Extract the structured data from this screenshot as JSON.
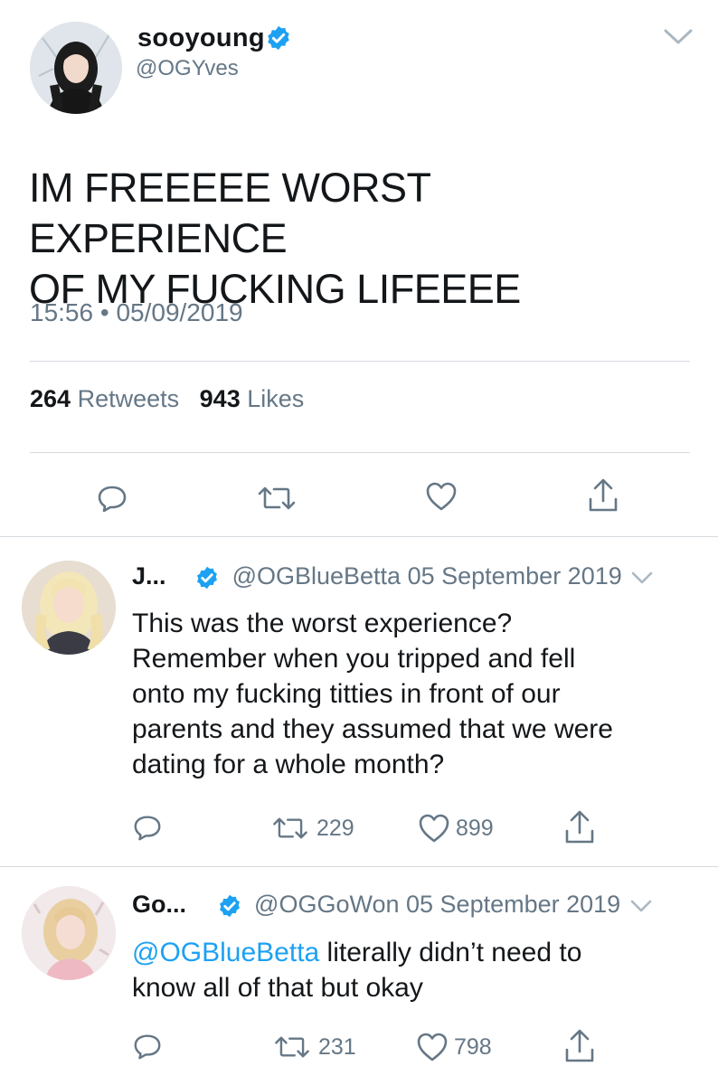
{
  "tweet": {
    "name": "sooyoung",
    "handle": "@OGYves",
    "text_line1": "IM FREEEEE WORST EXPERIENCE",
    "text_line2": "OF MY FUCKING LIFEEEE",
    "time": "15:56",
    "date": "05/09/2019",
    "retweets_count": "264",
    "retweets_label": "Retweets",
    "likes_count": "943",
    "likes_label": "Likes"
  },
  "replies": [
    {
      "name": "J...",
      "handle": "@OGBlueBetta",
      "date": "05 September 2019",
      "lines": [
        "This was the worst experience?",
        "Remember when you tripped and fell",
        "onto my fucking titties in front of our",
        "parents and they assumed that we were",
        "dating for a whole month?"
      ],
      "retweets": "229",
      "likes": "899"
    },
    {
      "name": "Go...",
      "handle": "@OGGoWon",
      "date": "05 September 2019",
      "mention": "@OGBlueBetta",
      "line1_rest": " literally didn’t need to",
      "line2": "know all of that but okay",
      "retweets": "231",
      "likes": "798"
    }
  ],
  "colors": {
    "accent": "#1da1f2",
    "secondary_text": "#657786",
    "icon": "#657786"
  },
  "icons": [
    "verified-badge-icon",
    "chevron-down-icon",
    "reply-icon",
    "retweet-icon",
    "like-icon",
    "share-icon"
  ]
}
